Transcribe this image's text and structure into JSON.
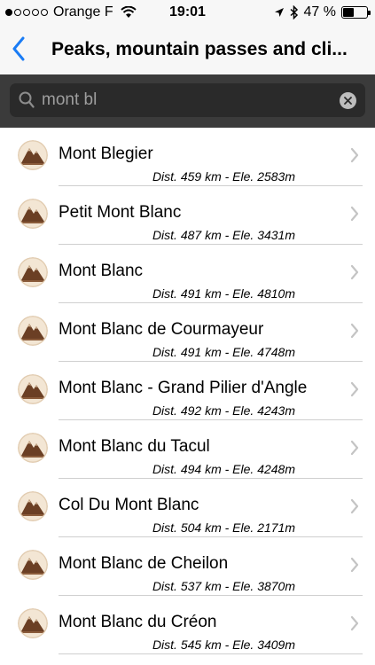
{
  "status": {
    "carrier": "Orange F",
    "time": "19:01",
    "battery_text": "47 %",
    "battery_level": 0.47
  },
  "nav": {
    "title": "Peaks, mountain passes and cli..."
  },
  "search": {
    "value": "mont bl"
  },
  "results": [
    {
      "name": "Mont Blegier",
      "meta": "Dist. 459 km - Ele. 2583m"
    },
    {
      "name": "Petit Mont Blanc",
      "meta": "Dist. 487 km - Ele. 3431m"
    },
    {
      "name": "Mont Blanc",
      "meta": "Dist. 491 km - Ele. 4810m"
    },
    {
      "name": "Mont Blanc de Courmayeur",
      "meta": "Dist. 491 km - Ele. 4748m"
    },
    {
      "name": "Mont Blanc - Grand Pilier d'Angle",
      "meta": "Dist. 492 km - Ele. 4243m"
    },
    {
      "name": "Mont Blanc du Tacul",
      "meta": "Dist. 494 km - Ele. 4248m"
    },
    {
      "name": "Col Du Mont Blanc",
      "meta": "Dist. 504 km - Ele. 2171m"
    },
    {
      "name": "Mont Blanc de Cheilon",
      "meta": "Dist. 537 km - Ele. 3870m"
    },
    {
      "name": "Mont Blanc du Créon",
      "meta": "Dist. 545 km - Ele. 3409m"
    }
  ],
  "colors": {
    "accent": "#1a7cf5",
    "search_bg": "#3b3b3b"
  }
}
